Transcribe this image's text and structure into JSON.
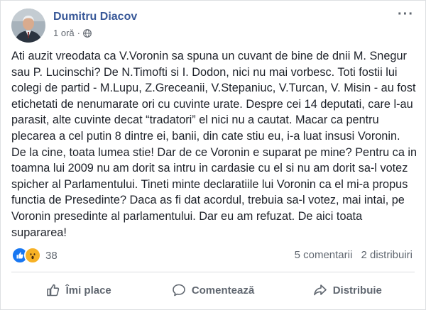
{
  "post": {
    "author": "Dumitru Diacov",
    "time": "1 oră",
    "body": "Ati auzit vreodata ca V.Voronin sa spuna un cuvant de bine de dnii M. Snegur sau P. Lucinschi? De N.Timofti si I. Dodon, nici nu mai vorbesc. Toti fostii lui colegi de partid - M.Lupu, Z.Greceanii, V.Stepaniuc, V.Turcan, V. Misin - au fost etichetati de nenumarate ori cu cuvinte urate. Despre cei 14 deputati, care l-au parasit, alte cuvinte decat “tradatori” el nici nu a cautat. Macar ca pentru plecarea a cel putin 8 dintre ei, banii, din cate stiu eu, i-a luat insusi Voronin. De la cine, toata lumea stie! Dar de ce Voronin e suparat pe mine? Pentru ca in toamna lui 2009 nu am dorit sa intru in cardasie cu el si nu am dorit sa-l votez spicher al Parlamentului. Tineti minte declaratiile lui Voronin ca el mi-a propus functia de Presedinte? Daca as fi dat acordul, trebuia sa-l votez, mai intai, pe Voronin presedinte al parlamentului. Dar eu am refuzat. De aici toata supararea!",
    "reactions": {
      "count": "38",
      "icons": [
        "like-icon",
        "wow-icon"
      ]
    },
    "comments": "5 comentarii",
    "shares": "2 distribuiri"
  },
  "actions": {
    "like": "Îmi place",
    "comment": "Comentează",
    "share": "Distribuie"
  },
  "colors": {
    "author": "#385898",
    "like_reaction": "#1877f2",
    "wow_reaction": "#f7b125",
    "muted_text": "#606770"
  }
}
